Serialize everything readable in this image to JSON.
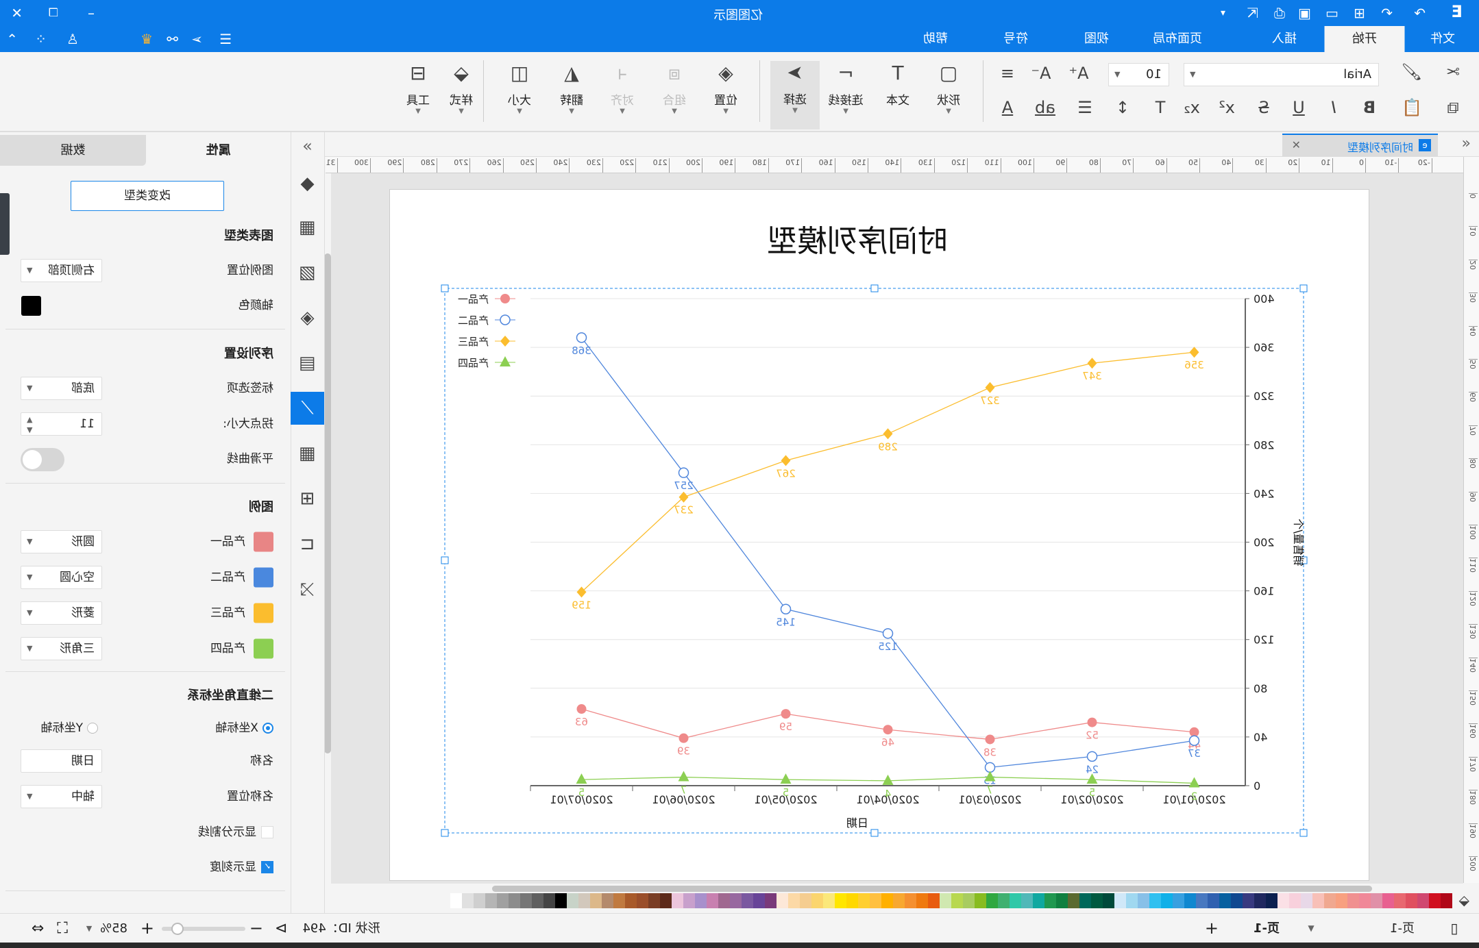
{
  "app": {
    "title": "亿图图示"
  },
  "menu": {
    "tabs": [
      "文件",
      "开始",
      "插入",
      "页面布局",
      "视图",
      "符号",
      "帮助"
    ],
    "active": "开始"
  },
  "toolbar": {
    "font": "Arial",
    "font_size": "10",
    "buttons": {
      "shape": "形状",
      "text": "文本",
      "connector": "连接线",
      "select": "选择",
      "position": "位置",
      "group": "组合",
      "align": "对齐",
      "flip": "翻转",
      "size": "大小",
      "style": "样式",
      "tools": "工具"
    }
  },
  "document": {
    "tab_title": "时间序列模型"
  },
  "ruler": {
    "h": [
      "-20",
      "-10",
      "0",
      "10",
      "20",
      "30",
      "40",
      "50",
      "60",
      "70",
      "80",
      "90",
      "100",
      "110",
      "120",
      "130",
      "140",
      "150",
      "160",
      "170",
      "180",
      "190",
      "200",
      "210",
      "220",
      "230",
      "240",
      "250",
      "260",
      "270",
      "280",
      "290",
      "300",
      "310"
    ],
    "v": [
      "0",
      "10",
      "20",
      "30",
      "40",
      "50",
      "60",
      "70",
      "80",
      "90",
      "100",
      "110",
      "120",
      "130",
      "140",
      "150",
      "160",
      "170",
      "180",
      "190",
      "200",
      "210"
    ]
  },
  "chart_data": {
    "type": "line",
    "title": "时间序列模型",
    "xlabel": "日期",
    "ylabel": "销售量/个",
    "categories": [
      "2020/01/01",
      "2020/02/01",
      "2020/03/01",
      "2020/04/01",
      "2020/05/01",
      "2020/06/01",
      "2020/07/01"
    ],
    "ylim": [
      0,
      400
    ],
    "yticks": [
      "0",
      "40",
      "80",
      "120",
      "160",
      "200",
      "240",
      "280",
      "320",
      "360",
      "400"
    ],
    "grid": true,
    "legend_position": "right-top",
    "series": [
      {
        "name": "产品一",
        "marker": "circle",
        "color": "#ef8a8a",
        "values": [
          44,
          52,
          38,
          46,
          59,
          39,
          63
        ]
      },
      {
        "name": "产品二",
        "marker": "hollow-circle",
        "color": "#4f86dc",
        "values": [
          37,
          24,
          15,
          125,
          145,
          257,
          368
        ]
      },
      {
        "name": "产品三",
        "marker": "diamond",
        "color": "#fbbd2e",
        "values": [
          356,
          347,
          327,
          289,
          267,
          237,
          159
        ]
      },
      {
        "name": "产品四",
        "marker": "triangle",
        "color": "#8ccf52",
        "values": [
          2,
          5,
          7,
          4,
          5,
          7,
          5
        ]
      }
    ]
  },
  "panel": {
    "tabs": [
      "属性",
      "数据"
    ],
    "change_type": "改变类型",
    "chart_type_heading": "图表类型",
    "legend_position_label": "图例位置",
    "legend_position_value": "右侧顶部",
    "axis_color_label": "轴颜色",
    "axis_color": "#000000",
    "series_heading": "序列设置",
    "label_option_label": "标签选项",
    "label_option_value": "底部",
    "point_size_label": "拐点大小:",
    "point_size_value": "11",
    "smooth_label": "平滑曲线",
    "smooth_on": false,
    "legend_heading": "图例",
    "legend_items": [
      {
        "name": "产品一",
        "color": "#e88585",
        "shape": "圆形"
      },
      {
        "name": "产品二",
        "color": "#4a88de",
        "shape": "空心圆"
      },
      {
        "name": "产品三",
        "color": "#fbbd2e",
        "shape": "菱形"
      },
      {
        "name": "产品四",
        "color": "#8ccf52",
        "shape": "三角形"
      }
    ],
    "coord_heading": "二维直角坐标系",
    "x_axis": "X坐标轴",
    "y_axis": "Y坐标轴",
    "axis_selected": "X坐标轴",
    "name_label": "名称",
    "name_value": "日期",
    "name_pos_label": "名称位置",
    "name_pos_value": "轴中",
    "show_grid_label": "显示分割线",
    "show_grid": false,
    "show_ticks_label": "显示刻度",
    "show_ticks": true
  },
  "status": {
    "page_label": "页-1",
    "page_tab": "页-1",
    "shape_id": "形状 ID：494",
    "zoom": "85%"
  },
  "palette": [
    "#ffffff",
    "#e0e0e0",
    "#cfcfcf",
    "#b5b5b5",
    "#a0a0a0",
    "#8c8c8c",
    "#767676",
    "#5f5f5f",
    "#444444",
    "#000000",
    "#c8d3c8",
    "#d2c8bc",
    "#dcb88a",
    "#b48a6c",
    "#c07a40",
    "#a85a2a",
    "#9a4e2a",
    "#7a3e25",
    "#5c2a1a",
    "#ecc5dc",
    "#c8a0cc",
    "#a890cc",
    "#c880b0",
    "#a06890",
    "#9868a0",
    "#7a58a0",
    "#684498",
    "#7a3a7a",
    "#fde8d8",
    "#fcd9a6",
    "#f5cd90",
    "#fbd56e",
    "#fbe87a",
    "#ffe600",
    "#ffd800",
    "#ffcf30",
    "#ffc040",
    "#ffb000",
    "#f8a830",
    "#f59030",
    "#ef7a10",
    "#e85c10",
    "#d0e8b0",
    "#b8d850",
    "#a8cc60",
    "#88bc20",
    "#30a840",
    "#40b070",
    "#30c8a8",
    "#50b8b8",
    "#10a8a0",
    "#209850",
    "#108040",
    "#5a6a30",
    "#00685a",
    "#005a40",
    "#004a3a",
    "#d0e8f8",
    "#a0d8f0",
    "#88c0e8",
    "#30c0f0",
    "#10b0e8",
    "#38a0e0",
    "#1088d0",
    "#4878c0",
    "#3060b0",
    "#0860a0",
    "#104890",
    "#383a80",
    "#202860",
    "#0c2050",
    "#fbe0e6",
    "#f8d0dc",
    "#e8d8e8",
    "#f8c0b8",
    "#f0a890",
    "#f8a080",
    "#f09090",
    "#f08898",
    "#e090a8",
    "#e86090",
    "#e86870",
    "#e05060",
    "#d04870",
    "#d01020",
    "#b00818"
  ]
}
